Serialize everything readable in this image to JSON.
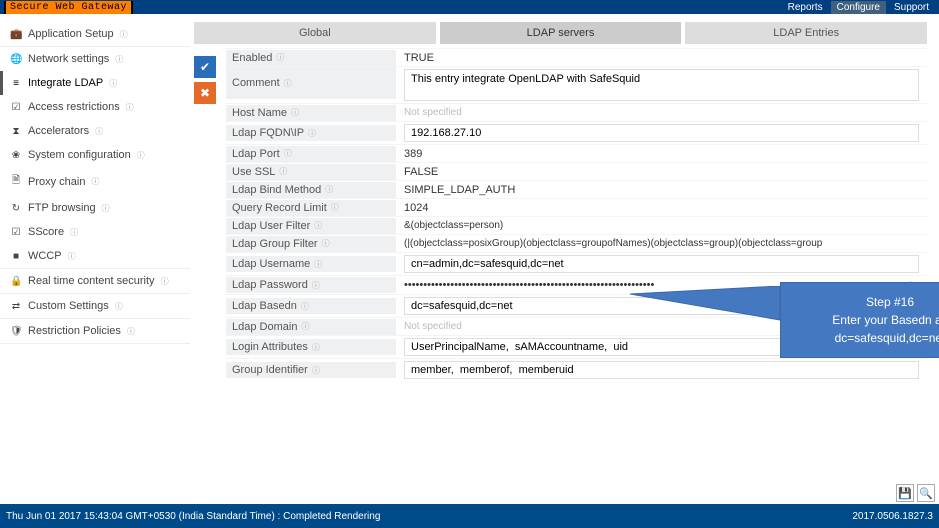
{
  "brand": "Secure Web Gateway",
  "topnav": {
    "reports": "Reports",
    "configure": "Configure",
    "support": "Support"
  },
  "sidebar": {
    "items": [
      {
        "icon": "💼",
        "label": "Application Setup"
      },
      {
        "icon": "🌐",
        "label": "Network settings"
      },
      {
        "icon": "≡",
        "label": "Integrate LDAP"
      },
      {
        "icon": "☑",
        "label": "Access restrictions"
      },
      {
        "icon": "⧗",
        "label": "Accelerators"
      },
      {
        "icon": "❀",
        "label": "System configuration"
      },
      {
        "icon": "🗎",
        "label": "Proxy chain"
      },
      {
        "icon": "↻",
        "label": "FTP browsing"
      },
      {
        "icon": "☑",
        "label": "SScore"
      },
      {
        "icon": "■",
        "label": "WCCP"
      },
      {
        "icon": "🔒",
        "label": "Real time content security"
      },
      {
        "icon": "⇄",
        "label": "Custom Settings"
      },
      {
        "icon": "🛡",
        "label": "Restriction Policies"
      }
    ]
  },
  "tabs": {
    "global": "Global",
    "servers": "LDAP servers",
    "entries": "LDAP Entries"
  },
  "form": {
    "enabled_label": "Enabled",
    "enabled_value": "TRUE",
    "comment_label": "Comment",
    "comment_value": "This entry integrate OpenLDAP with SafeSquid",
    "hostname_label": "Host Name",
    "hostname_value": "Not specified",
    "fqdn_label": "Ldap FQDN\\IP",
    "fqdn_value": "192.168.27.10",
    "port_label": "Ldap Port",
    "port_value": "389",
    "ssl_label": "Use SSL",
    "ssl_value": "FALSE",
    "bind_label": "Ldap Bind Method",
    "bind_value": "SIMPLE_LDAP_AUTH",
    "reclimit_label": "Query Record Limit",
    "reclimit_value": "1024",
    "userfilter_label": "Ldap User Filter",
    "userfilter_value": "&(objectclass=person)",
    "groupfilter_label": "Ldap Group Filter",
    "groupfilter_value": "(|(objectclass=posixGroup)(objectclass=groupofNames)(objectclass=group)(objectclass=group",
    "username_label": "Ldap Username",
    "username_value": "cn=admin,dc=safesquid,dc=net",
    "password_label": "Ldap Password",
    "password_value": "•••••••••••••••••••••••••••••••••••••••••••••••••••••••••••••••••",
    "basedn_label": "Ldap Basedn",
    "basedn_value": "dc=safesquid,dc=net",
    "domain_label": "Ldap Domain",
    "domain_value": "Not specified",
    "loginattr_label": "Login Attributes",
    "loginattr_value": "UserPrincipalName,  sAMAccountname,  uid",
    "groupid_label": "Group Identifier",
    "groupid_value": "member,  memberof,  memberuid"
  },
  "callout": {
    "title": "Step #16",
    "line1": "Enter your Basedn as",
    "line2": "dc=safesquid,dc=net"
  },
  "footer": {
    "left": "Thu Jun 01 2017 15:43:04 GMT+0530 (India Standard Time) : Completed Rendering",
    "right": "2017.0506.1827.3"
  }
}
